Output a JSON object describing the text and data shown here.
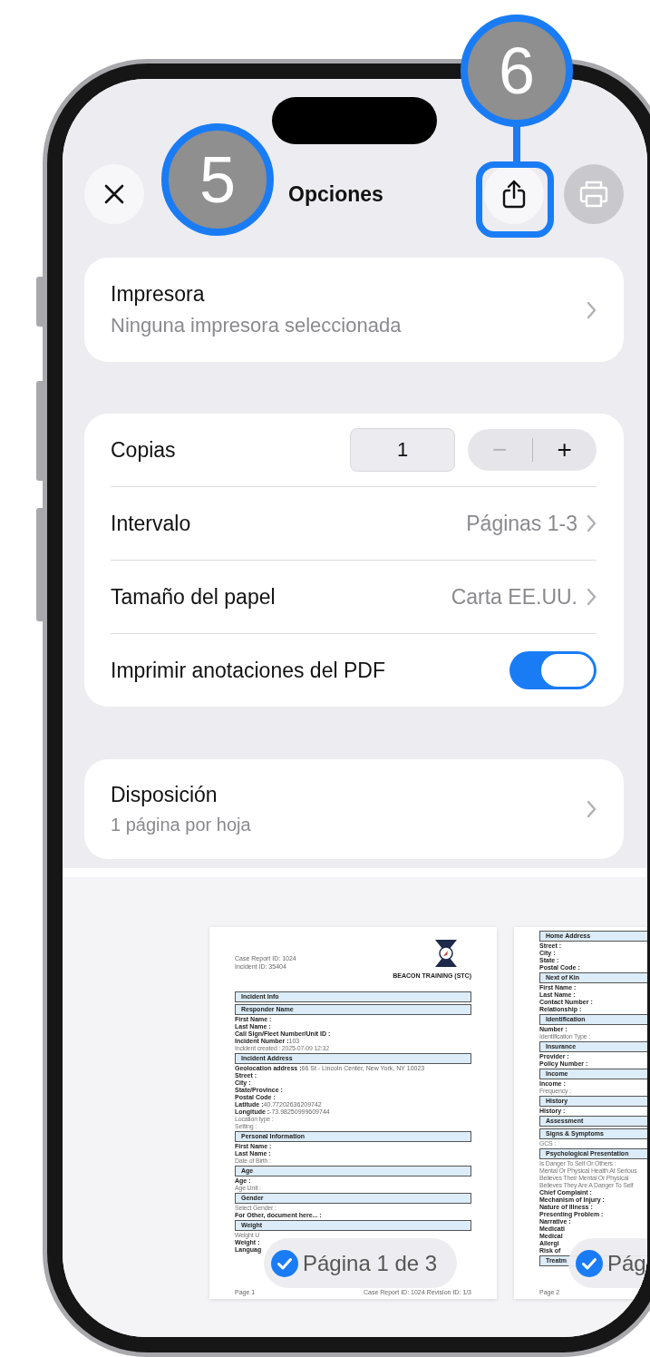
{
  "annotations": [
    {
      "label": "5"
    },
    {
      "label": "6"
    }
  ],
  "nav": {
    "title": "Opciones",
    "print_disabled": true
  },
  "printer": {
    "label": "Impresora",
    "value": "Ninguna impresora seleccionada"
  },
  "settings": [
    {
      "kind": "stepper",
      "label": "Copias",
      "value": "1",
      "decrement": "−",
      "increment": "+",
      "decrement_disabled": true
    },
    {
      "kind": "link",
      "label": "Intervalo",
      "value": "Páginas 1-3"
    },
    {
      "kind": "link",
      "label": "Tamaño del papel",
      "value": "Carta EE.UU."
    },
    {
      "kind": "toggle",
      "label": "Imprimir anotaciones del PDF",
      "on": true
    }
  ],
  "layout": {
    "label": "Disposición",
    "value": "1 página por hoja"
  },
  "pages": [
    {
      "selected": true,
      "badge": "Página 1 de 3",
      "header_lines": [
        "Case Report ID: 1024",
        "Incident ID: 35404"
      ],
      "logo_caption": "BEACON TRAINING (STC)",
      "footer_left": "Page 1",
      "footer_right": "Case Report ID: 1024 Revision ID: 1/3",
      "lines": [
        {
          "kind": "section",
          "text": "Incident Info"
        },
        {
          "kind": "section",
          "text": "Responder Name"
        },
        {
          "kind": "field",
          "label": "First Name :"
        },
        {
          "kind": "field",
          "label": "Last Name :"
        },
        {
          "kind": "field",
          "label": "Call Sign/Fleet Number/Unit ID :"
        },
        {
          "kind": "field",
          "label": "Incident Number :",
          "value": "103"
        },
        {
          "kind": "note",
          "text": "Incident created : 2025-07-09 12:32"
        },
        {
          "kind": "section",
          "text": "Incident Address"
        },
        {
          "kind": "field",
          "label": "Geolocation address :",
          "value": "66 St - Lincoln Center, New York, NY 10023"
        },
        {
          "kind": "field",
          "label": "Street :"
        },
        {
          "kind": "field",
          "label": "City :"
        },
        {
          "kind": "field",
          "label": "State/Province :"
        },
        {
          "kind": "field",
          "label": "Postal Code :"
        },
        {
          "kind": "field",
          "label": "Latitude :",
          "value": "40.77202636209742"
        },
        {
          "kind": "field",
          "label": "Longitude :",
          "value": "-73.98250999609744"
        },
        {
          "kind": "note",
          "text": "Location type :"
        },
        {
          "kind": "note",
          "text": "Setting :"
        },
        {
          "kind": "section",
          "text": "Personal Information"
        },
        {
          "kind": "field",
          "label": "First Name :"
        },
        {
          "kind": "field",
          "label": "Last Name :"
        },
        {
          "kind": "note",
          "text": "Date of Birth :"
        },
        {
          "kind": "section",
          "text": "Age"
        },
        {
          "kind": "field",
          "label": "Age :"
        },
        {
          "kind": "note",
          "text": "Age Unit :"
        },
        {
          "kind": "section",
          "text": "Gender"
        },
        {
          "kind": "note",
          "text": "Select Gender :"
        },
        {
          "kind": "field",
          "label": "For Other, document here... :"
        },
        {
          "kind": "section",
          "text": "Weight"
        },
        {
          "kind": "note",
          "text": "Weight U"
        },
        {
          "kind": "field",
          "label": "Weight :"
        },
        {
          "kind": "field",
          "label": "Languag"
        }
      ]
    },
    {
      "selected": true,
      "badge": "Pág",
      "footer_left": "Page 2",
      "lines": [
        {
          "kind": "section",
          "text": "Home Address"
        },
        {
          "kind": "field",
          "label": "Street :"
        },
        {
          "kind": "field",
          "label": "City :"
        },
        {
          "kind": "field",
          "label": "State :"
        },
        {
          "kind": "field",
          "label": "Postal Code :"
        },
        {
          "kind": "section",
          "text": "Next of Kin"
        },
        {
          "kind": "field",
          "label": "First Name :"
        },
        {
          "kind": "field",
          "label": "Last Name :"
        },
        {
          "kind": "field",
          "label": "Contact Number :"
        },
        {
          "kind": "field",
          "label": "Relationship :"
        },
        {
          "kind": "section",
          "text": "Identification"
        },
        {
          "kind": "field",
          "label": "Number :"
        },
        {
          "kind": "note",
          "text": "Identification Type :"
        },
        {
          "kind": "section",
          "text": "Insurance"
        },
        {
          "kind": "field",
          "label": "Provider :"
        },
        {
          "kind": "field",
          "label": "Policy Number :"
        },
        {
          "kind": "section",
          "text": "Income"
        },
        {
          "kind": "field",
          "label": "Income :"
        },
        {
          "kind": "note",
          "text": "Frequency :"
        },
        {
          "kind": "section",
          "text": "History"
        },
        {
          "kind": "field",
          "label": "History :"
        },
        {
          "kind": "section",
          "text": "Assessment"
        },
        {
          "kind": "section",
          "text": "Signs & Symptoms"
        },
        {
          "kind": "note",
          "text": "GCS :"
        },
        {
          "kind": "section",
          "text": "Psychological Presentation"
        },
        {
          "kind": "note",
          "text": "Is Danger To Self Or Others :"
        },
        {
          "kind": "note",
          "text": "Mental Or Physical Health At Serious"
        },
        {
          "kind": "note",
          "text": "Believes Their Mental Or Physical"
        },
        {
          "kind": "note",
          "text": "Believes They Are A Danger To Self"
        },
        {
          "kind": "field",
          "label": "Chief Complaint :"
        },
        {
          "kind": "field",
          "label": "Mechanism of Injury :"
        },
        {
          "kind": "field",
          "label": "Nature of Illness :"
        },
        {
          "kind": "field",
          "label": "Presenting Problem :"
        },
        {
          "kind": "field",
          "label": "Narrative :"
        },
        {
          "kind": "field",
          "label": "Medicati"
        },
        {
          "kind": "field",
          "label": "Medical"
        },
        {
          "kind": "field",
          "label": "Allergi"
        },
        {
          "kind": "field",
          "label": "Risk of"
        },
        {
          "kind": "section",
          "text": "Treatm"
        }
      ]
    }
  ]
}
